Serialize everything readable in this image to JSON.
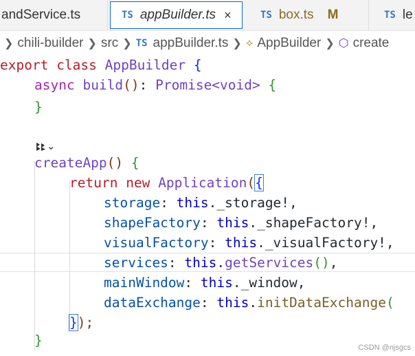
{
  "tabs": [
    {
      "label": "andService.ts",
      "lang": ""
    },
    {
      "label": "appBuilder.ts",
      "lang": "TS",
      "close": "×"
    },
    {
      "label": "box.ts",
      "lang": "TS",
      "status": "M"
    },
    {
      "label": "le",
      "lang": "TS"
    }
  ],
  "breadcrumb": {
    "items": [
      "chili-builder",
      "src",
      "appBuilder.ts",
      "AppBuilder",
      "create"
    ],
    "file_lang": "TS"
  },
  "code": {
    "l1": {
      "kw": "export",
      "kw2": "class",
      "name": "AppBuilder",
      "brace": "{"
    },
    "l2": {
      "kw": "async",
      "fn": "build",
      "paren": "()",
      "colon": ": ",
      "type": "Promise<void>",
      "brace": "{"
    },
    "l3": {
      "brace": "}"
    },
    "l5": {
      "fn": "createApp",
      "paren": "()",
      "brace": "{"
    },
    "l6": {
      "kw": "return",
      "kw2": "new",
      "cls": "Application",
      "paren": "(",
      "brace": "{"
    },
    "l7": {
      "prop": "storage",
      "colon": ": ",
      "this": "this",
      "rest": "._storage!,"
    },
    "l8": {
      "prop": "shapeFactory",
      "colon": ": ",
      "this": "this",
      "rest": "._shapeFactory!,"
    },
    "l9": {
      "prop": "visualFactory",
      "colon": ": ",
      "this": "this",
      "rest": "._visualFactory!,"
    },
    "l10": {
      "prop": "services",
      "colon": ": ",
      "this": "this",
      "dot": ".",
      "fn": "getServices",
      "paren": "()",
      "comma": ","
    },
    "l11": {
      "prop": "mainWindow",
      "colon": ": ",
      "this": "this",
      "rest": "._window,"
    },
    "l12": {
      "prop": "dataExchange",
      "colon": ": ",
      "this": "this",
      "dot": ".",
      "fn": "initDataExchange",
      "paren": "("
    },
    "l13": {
      "brace": "}",
      "rest": ");"
    },
    "l14": {
      "brace": "}"
    }
  },
  "codelens": {
    "icon": "copilot-icon",
    "chevron": "⌄"
  },
  "watermark": "CSDN @njsgcs"
}
